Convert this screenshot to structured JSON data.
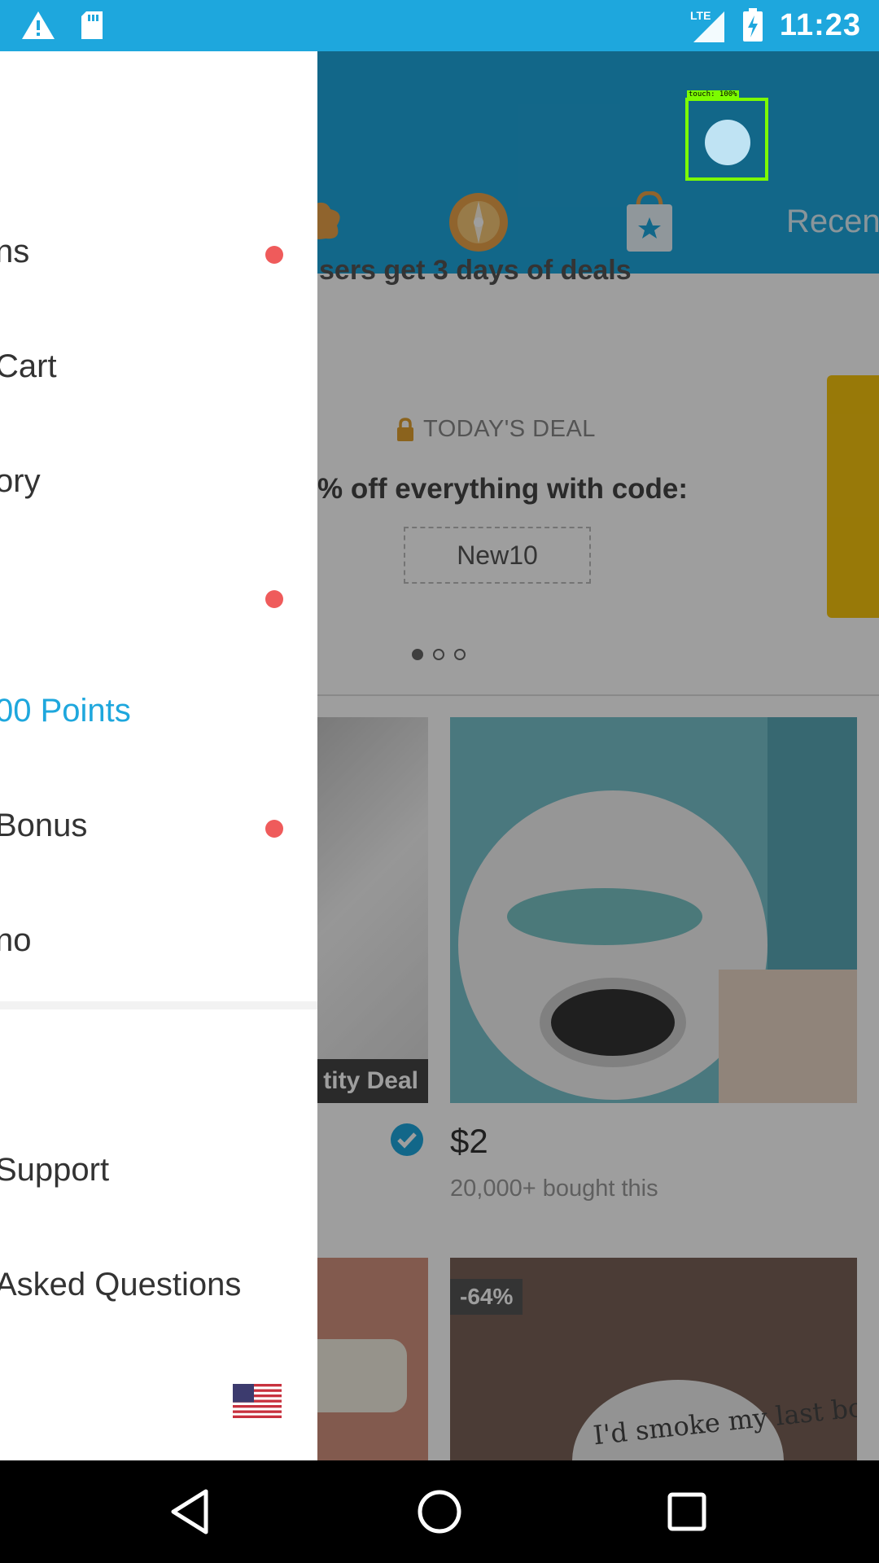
{
  "status_bar": {
    "time": "11:23",
    "network": "LTE",
    "icons": [
      "warning-icon",
      "sd-card-icon",
      "signal-icon",
      "battery-charging-icon"
    ],
    "bg_color": "#1ea7dd"
  },
  "header": {
    "tab_label": "Recen",
    "icons": [
      "puzzle-tab-icon",
      "wheel-tab-icon",
      "bag-star-tab-icon"
    ]
  },
  "touch_indicator": {
    "label": "touch: 100%"
  },
  "promo": {
    "line": "sers get 3 days of deals",
    "deal_tag": "TODAY'S DEAL",
    "deal_text": "% off everything with code:",
    "code": "New10",
    "carousel_dots": 3,
    "active_dot": 0
  },
  "products": [
    {
      "label": "tity Deal"
    },
    {
      "price": "$2",
      "bought": "20,000+ bought this"
    },
    {
      "discount": "-64%",
      "tag_text": "I'd smoke my last bowl"
    }
  ],
  "drawer": {
    "items": [
      {
        "label": "ns",
        "has_dot": true
      },
      {
        "label": "Cart",
        "has_dot": false
      },
      {
        "label": "ory",
        "has_dot": false
      },
      {
        "label": "",
        "has_dot": true
      },
      {
        "label": "00 Points",
        "has_dot": false,
        "accent": true
      },
      {
        "label": " Bonus",
        "has_dot": true
      },
      {
        "label": "no",
        "has_dot": false
      },
      {
        "label": "Support",
        "has_dot": false
      },
      {
        "label": " Asked Questions",
        "has_dot": false
      }
    ],
    "accent_color": "#1ea7dd",
    "dot_color": "#ef5b5b",
    "flag": "us-flag-icon"
  },
  "nav_bar": {
    "buttons": [
      "back-icon",
      "home-icon",
      "recents-icon"
    ]
  }
}
